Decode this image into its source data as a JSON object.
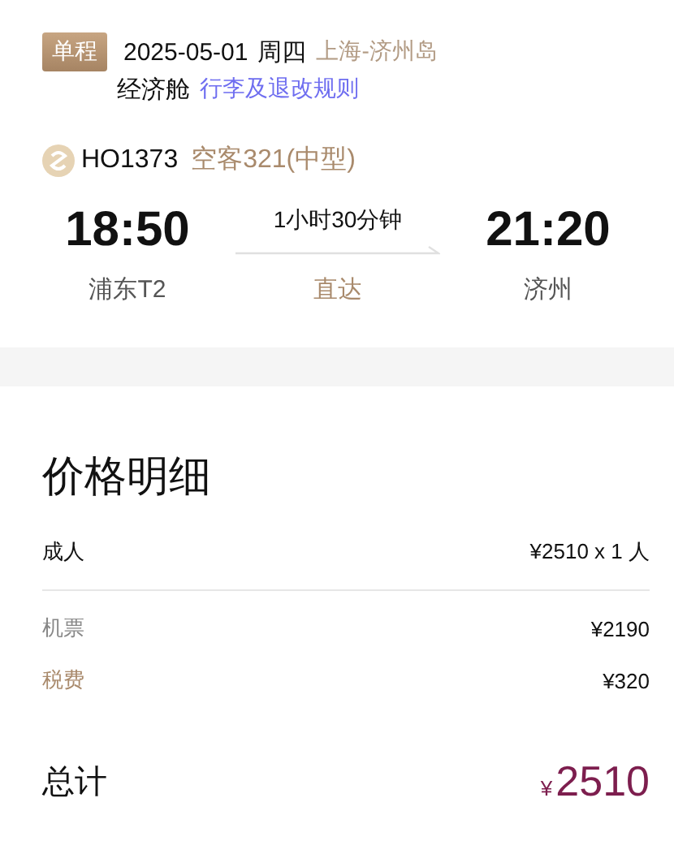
{
  "trip": {
    "badge": "单程",
    "date": "2025-05-01",
    "weekday": "周四",
    "route": "上海-济州岛",
    "cabin": "经济舱",
    "rules_link": "行李及退改规则"
  },
  "flight": {
    "number": "HO1373",
    "aircraft": "空客321(中型)",
    "departure_time": "18:50",
    "duration": "1小时30分钟",
    "arrival_time": "21:20",
    "departure_airport": "浦东T2",
    "stop_type": "直达",
    "arrival_airport": "济州"
  },
  "price_details": {
    "title": "价格明细",
    "passenger": {
      "label": "成人",
      "value": "¥2510 x 1 人"
    },
    "lines": [
      {
        "label": "机票",
        "value": "¥2190",
        "color": "#888888"
      },
      {
        "label": "税费",
        "value": "¥320",
        "color": "#a98a6c"
      }
    ],
    "total": {
      "label": "总计",
      "currency": "¥",
      "amount": "2510"
    }
  }
}
